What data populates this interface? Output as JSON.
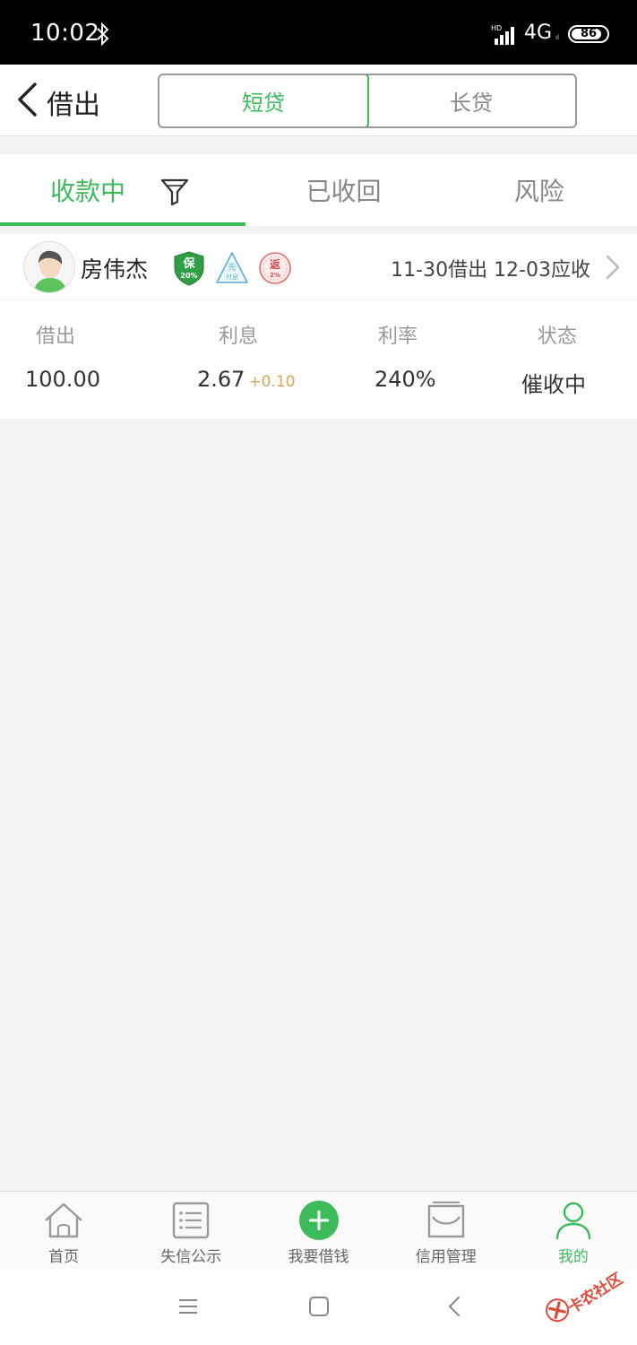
{
  "status_bar": {
    "time": "10:02",
    "network": "4G",
    "network_sub": "ıl",
    "signal_label": "HD",
    "battery": "86",
    "battery_level": 0.86
  },
  "header": {
    "title": "借出",
    "segments": [
      {
        "label": "短贷",
        "active": true
      },
      {
        "label": "长贷",
        "active": false
      }
    ]
  },
  "tabs": [
    {
      "label": "收款中",
      "active": true
    },
    {
      "label": "已收回",
      "active": false
    },
    {
      "label": "风险",
      "active": false
    }
  ],
  "loan": {
    "borrower": "房伟杰",
    "badges": {
      "bao": {
        "main": "保",
        "sub": "20%"
      },
      "xian": {
        "main": "先",
        "sub": "付息"
      },
      "fan": {
        "main": "返",
        "sub": "2%"
      }
    },
    "dates": "11-30借出 12-03应收",
    "columns": [
      {
        "label": "借出",
        "value": "100.00",
        "extra": ""
      },
      {
        "label": "利息",
        "value": "2.67",
        "extra": "+0.10"
      },
      {
        "label": "利率",
        "value": "240%",
        "extra": ""
      },
      {
        "label": "状态",
        "value": "催收中",
        "extra": ""
      }
    ]
  },
  "bottom_nav": [
    {
      "label": "首页",
      "icon": "home-icon",
      "active": false
    },
    {
      "label": "失信公示",
      "icon": "list-icon",
      "active": false
    },
    {
      "label": "我要借钱",
      "icon": "plus-circle-icon",
      "active": false
    },
    {
      "label": "信用管理",
      "icon": "envelope-icon",
      "active": false
    },
    {
      "label": "我的",
      "icon": "user-icon",
      "active": true
    }
  ],
  "watermark": "卡农社区",
  "colors": {
    "accent": "#3dbb5a",
    "interest_extra": "#d8a84e",
    "status_bar": "#000000",
    "background": "#f2f2f2"
  }
}
